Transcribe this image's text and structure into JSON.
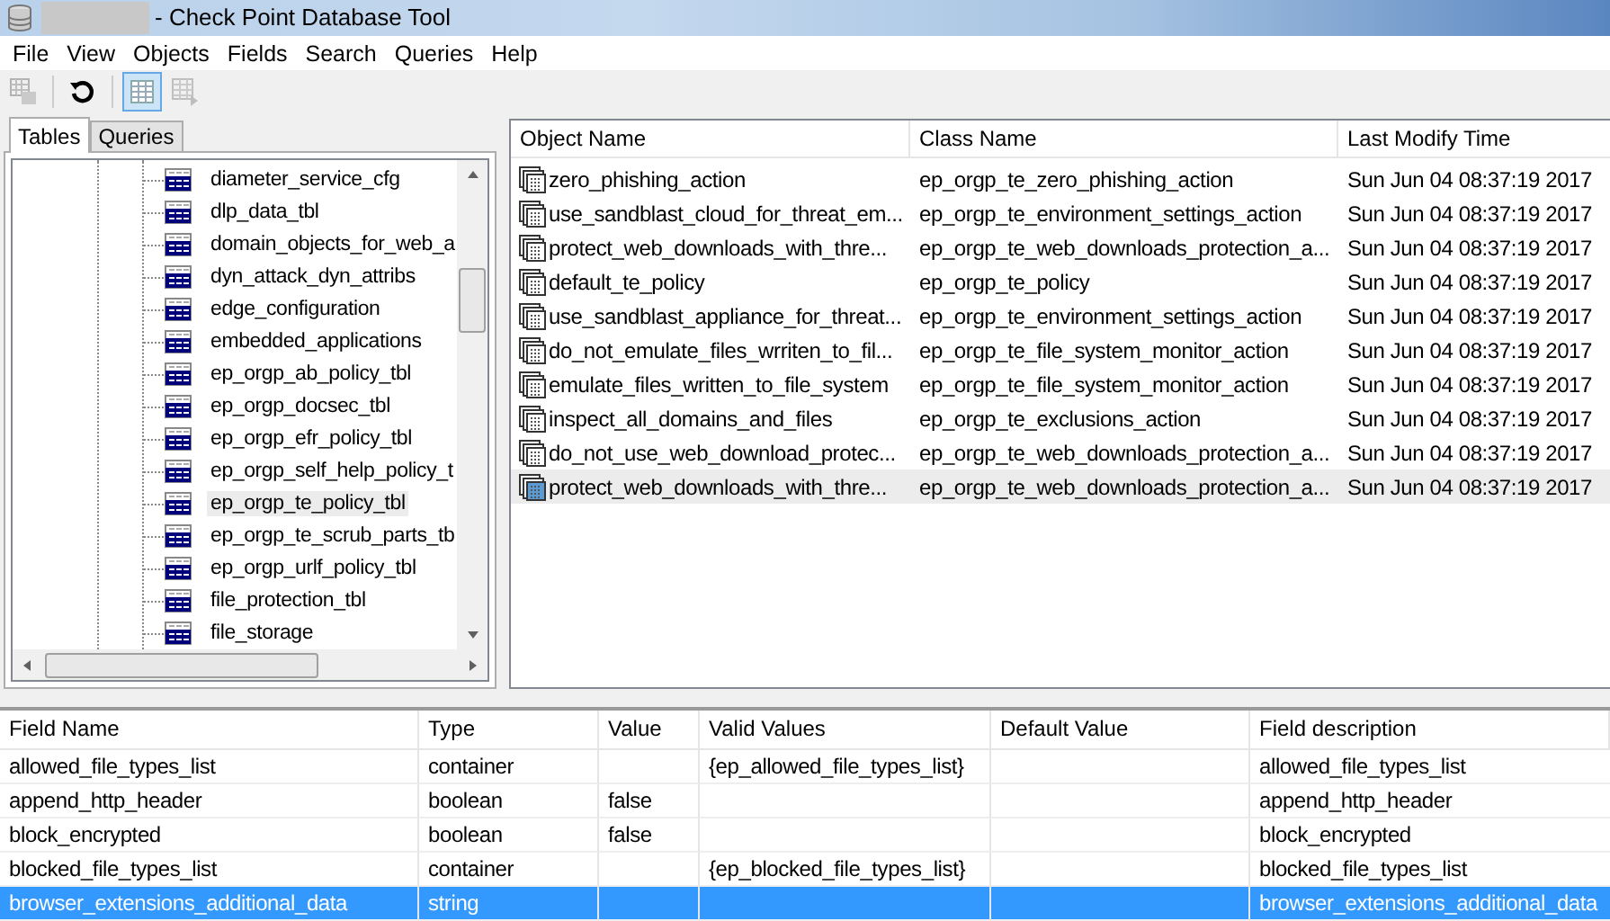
{
  "window": {
    "title": "- Check Point Database Tool"
  },
  "menu": [
    "File",
    "View",
    "Objects",
    "Fields",
    "Search",
    "Queries",
    "Help"
  ],
  "toolbar": [
    {
      "kind": "save",
      "disabled": true,
      "pressed": false
    },
    {
      "kind": "refresh",
      "disabled": false,
      "pressed": false
    },
    {
      "kind": "grid",
      "disabled": false,
      "pressed": true
    },
    {
      "kind": "grid-edit",
      "disabled": true,
      "pressed": false
    }
  ],
  "tabs": [
    {
      "label": "Tables",
      "selected": true
    },
    {
      "label": "Queries",
      "selected": false
    }
  ],
  "tree": {
    "items": [
      {
        "label": "diameter_service_cfg",
        "selected": false
      },
      {
        "label": "dlp_data_tbl",
        "selected": false
      },
      {
        "label": "domain_objects_for_web_a",
        "selected": false
      },
      {
        "label": "dyn_attack_dyn_attribs",
        "selected": false
      },
      {
        "label": "edge_configuration",
        "selected": false
      },
      {
        "label": "embedded_applications",
        "selected": false
      },
      {
        "label": "ep_orgp_ab_policy_tbl",
        "selected": false
      },
      {
        "label": "ep_orgp_docsec_tbl",
        "selected": false
      },
      {
        "label": "ep_orgp_efr_policy_tbl",
        "selected": false
      },
      {
        "label": "ep_orgp_self_help_policy_t",
        "selected": false
      },
      {
        "label": "ep_orgp_te_policy_tbl",
        "selected": true
      },
      {
        "label": "ep_orgp_te_scrub_parts_tb",
        "selected": false
      },
      {
        "label": "ep_orgp_urlf_policy_tbl",
        "selected": false
      },
      {
        "label": "file_protection_tbl",
        "selected": false
      },
      {
        "label": "file_storage",
        "selected": false
      }
    ]
  },
  "objects": {
    "columns": [
      "Object Name",
      "Class Name",
      "Last Modify Time"
    ],
    "rows": [
      {
        "cells": [
          "zero_phishing_action",
          "ep_orgp_te_zero_phishing_action",
          "Sun Jun 04 08:37:19 2017"
        ],
        "selected": false
      },
      {
        "cells": [
          "use_sandblast_cloud_for_threat_em...",
          "ep_orgp_te_environment_settings_action",
          "Sun Jun 04 08:37:19 2017"
        ],
        "selected": false
      },
      {
        "cells": [
          "protect_web_downloads_with_thre...",
          "ep_orgp_te_web_downloads_protection_a...",
          "Sun Jun 04 08:37:19 2017"
        ],
        "selected": false
      },
      {
        "cells": [
          "default_te_policy",
          "ep_orgp_te_policy",
          "Sun Jun 04 08:37:19 2017"
        ],
        "selected": false
      },
      {
        "cells": [
          "use_sandblast_appliance_for_threat...",
          "ep_orgp_te_environment_settings_action",
          "Sun Jun 04 08:37:19 2017"
        ],
        "selected": false
      },
      {
        "cells": [
          "do_not_emulate_files_wrriten_to_fil...",
          "ep_orgp_te_file_system_monitor_action",
          "Sun Jun 04 08:37:19 2017"
        ],
        "selected": false
      },
      {
        "cells": [
          "emulate_files_written_to_file_system",
          "ep_orgp_te_file_system_monitor_action",
          "Sun Jun 04 08:37:19 2017"
        ],
        "selected": false
      },
      {
        "cells": [
          "inspect_all_domains_and_files",
          "ep_orgp_te_exclusions_action",
          "Sun Jun 04 08:37:19 2017"
        ],
        "selected": false
      },
      {
        "cells": [
          "do_not_use_web_download_protec...",
          "ep_orgp_te_web_downloads_protection_a...",
          "Sun Jun 04 08:37:19 2017"
        ],
        "selected": false
      },
      {
        "cells": [
          "protect_web_downloads_with_thre...",
          "ep_orgp_te_web_downloads_protection_a...",
          "Sun Jun 04 08:37:19 2017"
        ],
        "selected": true
      }
    ]
  },
  "fields": {
    "columns": [
      "Field Name",
      "Type",
      "Value",
      "Valid Values",
      "Default Value",
      "Field description"
    ],
    "rows": [
      {
        "cells": [
          "allowed_file_types_list",
          "container",
          "",
          "{ep_allowed_file_types_list}",
          "",
          "allowed_file_types_list"
        ],
        "selected": false
      },
      {
        "cells": [
          "append_http_header",
          "boolean",
          "false",
          "",
          "",
          "append_http_header"
        ],
        "selected": false
      },
      {
        "cells": [
          "block_encrypted",
          "boolean",
          "false",
          "",
          "",
          "block_encrypted"
        ],
        "selected": false
      },
      {
        "cells": [
          "blocked_file_types_list",
          "container",
          "",
          "{ep_blocked_file_types_list}",
          "",
          "blocked_file_types_list"
        ],
        "selected": false
      },
      {
        "cells": [
          "browser_extensions_additional_data",
          "string",
          "",
          "",
          "",
          "browser_extensions_additional_data"
        ],
        "selected": true
      }
    ]
  }
}
